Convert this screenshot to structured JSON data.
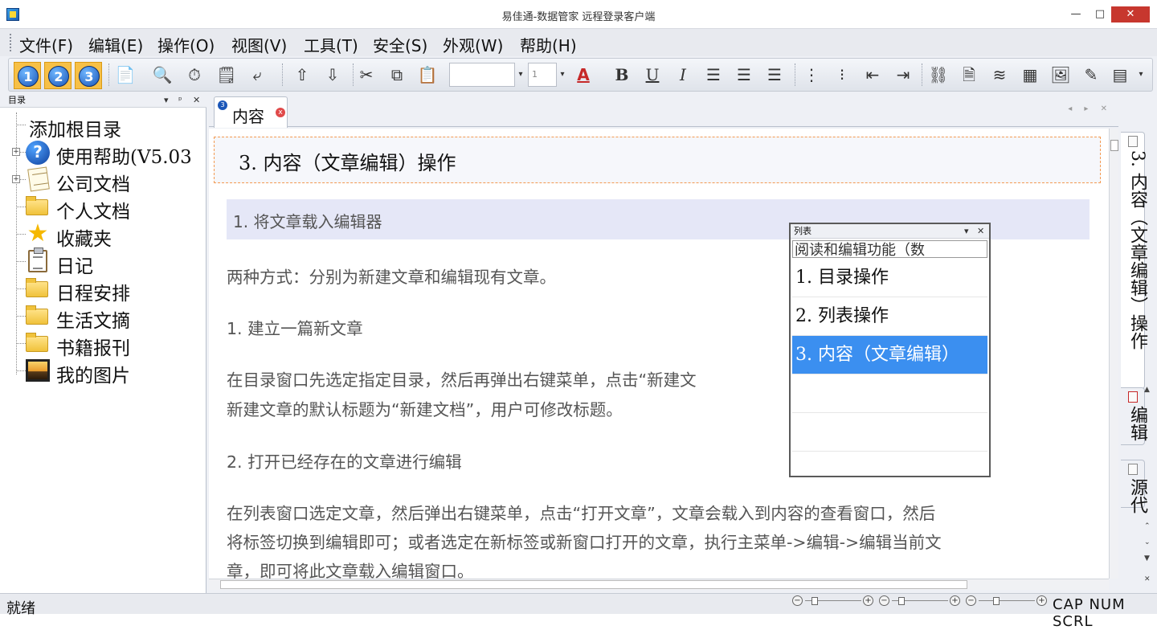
{
  "window": {
    "title": "易佳通-数据管家 远程登录客户端"
  },
  "menu": [
    "文件(F)",
    "编辑(E)",
    "操作(O)",
    "视图(V)",
    "工具(T)",
    "安全(S)",
    "外观(W)",
    "帮助(H)"
  ],
  "toolbar": {
    "level_buttons": [
      "1",
      "2",
      "3"
    ],
    "font_size_value": "1",
    "bold_label": "B",
    "underline_label": "U",
    "italic_label": "I",
    "font_color_label": "A"
  },
  "left_panel": {
    "title": "目录",
    "pin": "▾ ᵖ ✕",
    "items": [
      {
        "label": "添加根目录",
        "icon": "none"
      },
      {
        "label": "使用帮助(V5.03",
        "icon": "help-circle-icon"
      },
      {
        "label": "公司文档",
        "icon": "notes-icon"
      },
      {
        "label": "个人文档",
        "icon": "folder-icon"
      },
      {
        "label": "收藏夹",
        "icon": "star-icon"
      },
      {
        "label": "日记",
        "icon": "clipboard-icon"
      },
      {
        "label": "日程安排",
        "icon": "folder-icon"
      },
      {
        "label": "生活文摘",
        "icon": "folder-icon"
      },
      {
        "label": "书籍报刊",
        "icon": "folder-icon"
      },
      {
        "label": "我的图片",
        "icon": "picture-icon"
      }
    ]
  },
  "tab": {
    "badge": "3",
    "label": "内容",
    "close": "x"
  },
  "document": {
    "title": "3. 内容（文章编辑）操作",
    "section": "1. 将文章载入编辑器",
    "p1": "两种方式：分别为新建文章和编辑现有文章。",
    "h1": "1. 建立一篇新文章",
    "p2a": "在目录窗口先选定指定目录，然后再弹出右键菜单，点击“新建文",
    "p2b": "新建文章的默认标题为“新建文档”，用户可修改标题。",
    "h2": "2. 打开已经存在的文章进行编辑",
    "p3a": "在列表窗口选定文章，然后弹出右键菜单，点击“打开文章”，文章会载入到内容的查看窗口，然后",
    "p3b": "将标签切换到编辑即可；或者选定在新标签或新窗口打开的文章，执行主菜单->编辑->编辑当前文",
    "p3c": "章，即可将此文章载入编辑窗口。"
  },
  "list_window": {
    "title": "列表",
    "header": "阅读和编辑功能（数",
    "rows": [
      "1. 目录操作",
      "2. 列表操作",
      "3. 内容（文章编辑）"
    ],
    "selected_index": 2
  },
  "right_tabs": [
    "3. 内容（文章编辑）操作",
    "编辑",
    "源代"
  ],
  "status": {
    "text": "就绪",
    "caps": "CAP NUM SCRL"
  }
}
